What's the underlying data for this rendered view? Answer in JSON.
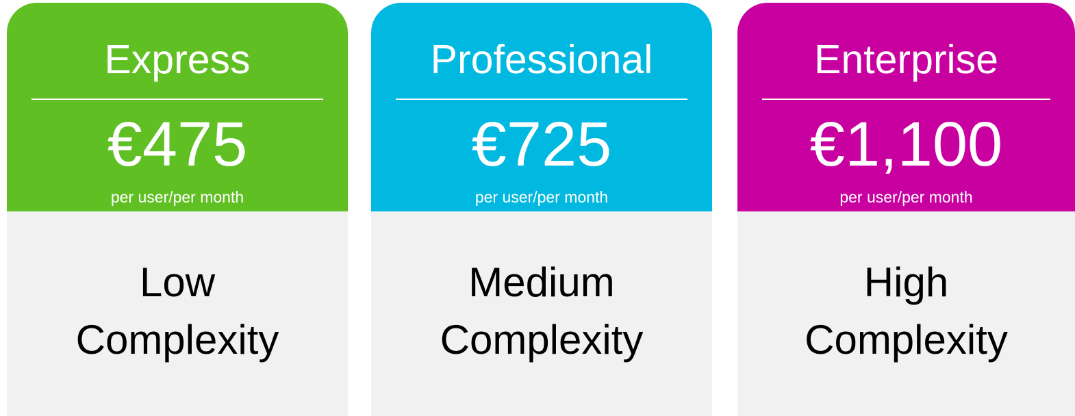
{
  "colors": {
    "express": "#5fbf23",
    "professional": "#00b8e0",
    "enterprise": "#c8009f",
    "panel": "#f1f1f1"
  },
  "plans": [
    {
      "name": "Express",
      "price": "€475",
      "period": "per user/per month",
      "complexity_line1": "Low",
      "complexity_line2": "Complexity"
    },
    {
      "name": "Professional",
      "price": "€725",
      "period": "per user/per month",
      "complexity_line1": "Medium",
      "complexity_line2": "Complexity"
    },
    {
      "name": "Enterprise",
      "price": "€1,100",
      "period": "per user/per month",
      "complexity_line1": "High",
      "complexity_line2": "Complexity"
    }
  ]
}
